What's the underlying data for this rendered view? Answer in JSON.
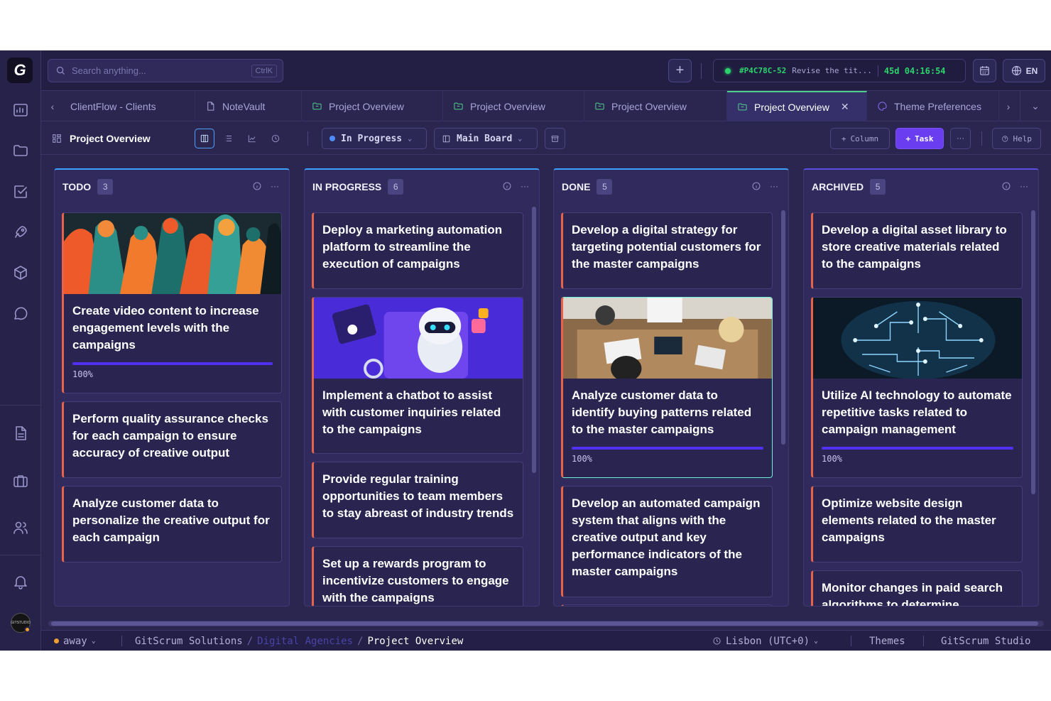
{
  "app": {
    "logo_glyph": "G"
  },
  "search": {
    "placeholder": "Search anything...",
    "shortcut": "CtrlK"
  },
  "timer": {
    "task_id": "#P4C78C-52",
    "task_text": "Revise the tit...",
    "elapsed": "45d 04:16:54"
  },
  "language": {
    "code": "EN"
  },
  "tabs": [
    {
      "label": "ClientFlow - Clients",
      "icon": "none"
    },
    {
      "label": "NoteVault",
      "icon": "file-icon"
    },
    {
      "label": "Project Overview",
      "icon": "folder-icon"
    },
    {
      "label": "Project Overview",
      "icon": "folder-icon"
    },
    {
      "label": "Project Overview",
      "icon": "folder-icon"
    },
    {
      "label": "Project Overview",
      "icon": "folder-icon",
      "active": true
    },
    {
      "label": "Theme Preferences",
      "icon": "palette-icon"
    }
  ],
  "toolbar": {
    "title": "Project Overview",
    "status_filter": "In Progress",
    "board_filter": "Main Board",
    "column_label": "Column",
    "task_label": "Task",
    "more_label": "···",
    "help_label": "Help"
  },
  "columns": [
    {
      "title": "TODO",
      "count": "3",
      "cards": [
        {
          "title": "Create video content to increase engagement levels with the campaigns",
          "image": "people-collage",
          "progress": 1.0,
          "progress_label": "100%"
        },
        {
          "title": "Perform quality assurance checks for each campaign to ensure accuracy of creative output"
        },
        {
          "title": "Analyze customer data to personalize the creative output for each campaign"
        }
      ]
    },
    {
      "title": "IN PROGRESS",
      "count": "6",
      "cards": [
        {
          "title": "Deploy a marketing automation platform to streamline the execution of campaigns"
        },
        {
          "title": "Implement a chatbot to assist with customer inquiries related to the campaigns",
          "image": "robot"
        },
        {
          "title": "Provide regular training opportunities to team members to stay abreast of industry trends"
        },
        {
          "title": "Set up a rewards program to incentivize customers to engage with the campaigns"
        }
      ]
    },
    {
      "title": "DONE",
      "count": "5",
      "cards": [
        {
          "title": "Develop a digital strategy for targeting potential customers for the master campaigns"
        },
        {
          "title": "Analyze customer data to identify buying patterns related to the master campaigns",
          "image": "meeting",
          "progress": 1.0,
          "progress_label": "100%",
          "selected": true
        },
        {
          "title": "Develop an automated campaign system that aligns with the creative output and key performance indicators of the master campaigns"
        }
      ]
    },
    {
      "title": "ARCHIVED",
      "count": "5",
      "cards": [
        {
          "title": "Develop a digital asset library to store creative materials related to the campaigns"
        },
        {
          "title": "Utilize AI technology to automate repetitive tasks related to campaign management",
          "image": "circuit-brain",
          "progress": 1.0,
          "progress_label": "100%"
        },
        {
          "title": "Optimize website design elements related to the master campaigns"
        },
        {
          "title": "Monitor changes in paid search algorithms to determine"
        }
      ]
    }
  ],
  "status_bar": {
    "presence": "away",
    "org": "GitScrum Solutions",
    "workspace": "Digital Agencies",
    "project": "Project Overview",
    "timezone": "Lisbon (UTC+0)",
    "themes": "Themes",
    "studio": "GitScrum Studio"
  },
  "colors": {
    "accent": "#6a3df0",
    "card_border": "#e8634a",
    "active_tab": "#4fd08a",
    "column_top": "#3d9fff"
  }
}
